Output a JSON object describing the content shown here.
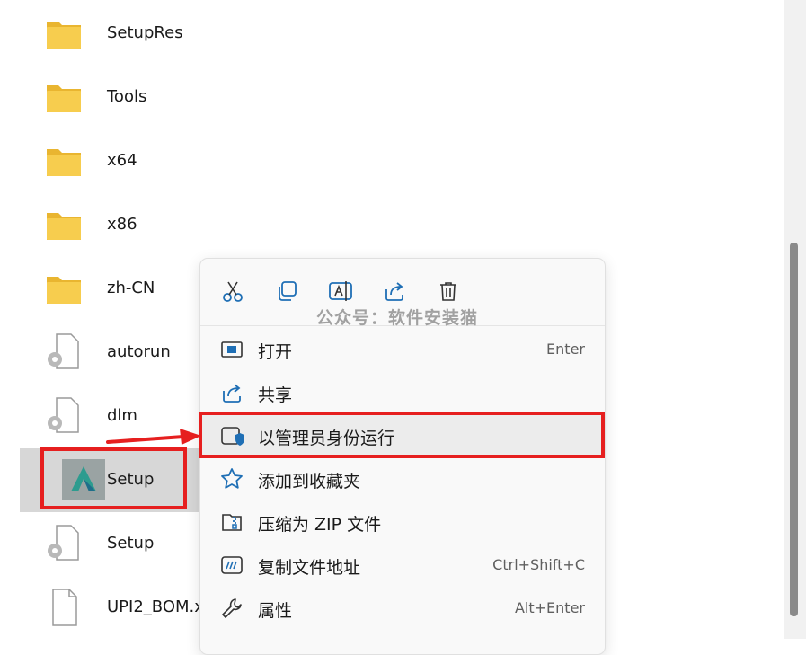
{
  "files": [
    {
      "name": "SetupRes",
      "type": "folder"
    },
    {
      "name": "Tools",
      "type": "folder"
    },
    {
      "name": "x64",
      "type": "folder"
    },
    {
      "name": "x86",
      "type": "folder"
    },
    {
      "name": "zh-CN",
      "type": "folder"
    },
    {
      "name": "autorun",
      "type": "settings-file"
    },
    {
      "name": "dlm",
      "type": "settings-file"
    },
    {
      "name": "Setup",
      "type": "app-exe",
      "selected": true
    },
    {
      "name": "Setup",
      "type": "settings-file"
    },
    {
      "name": "UPI2_BOM.x",
      "type": "file"
    }
  ],
  "context_menu": {
    "quick_actions": [
      "cut-icon",
      "copy-icon",
      "rename-icon",
      "share-icon",
      "delete-icon"
    ],
    "items": [
      {
        "label": "打开",
        "shortcut": "Enter",
        "icon": "open-icon"
      },
      {
        "label": "共享",
        "shortcut": "",
        "icon": "share-icon"
      },
      {
        "label": "以管理员身份运行",
        "shortcut": "",
        "icon": "run-as-admin-icon",
        "highlight": true
      },
      {
        "label": "添加到收藏夹",
        "shortcut": "",
        "icon": "star-icon"
      },
      {
        "label": "压缩为 ZIP 文件",
        "shortcut": "",
        "icon": "zip-icon"
      },
      {
        "label": "复制文件地址",
        "shortcut": "Ctrl+Shift+C",
        "icon": "copy-path-icon"
      },
      {
        "label": "属性",
        "shortcut": "Alt+Enter",
        "icon": "wrench-icon"
      }
    ]
  },
  "watermark": "公众号：软件安装猫",
  "colors": {
    "accent": "#0067c0",
    "annotation": "#e61f1f",
    "folder": "#f4c542",
    "selection": "#d7d7d7"
  }
}
